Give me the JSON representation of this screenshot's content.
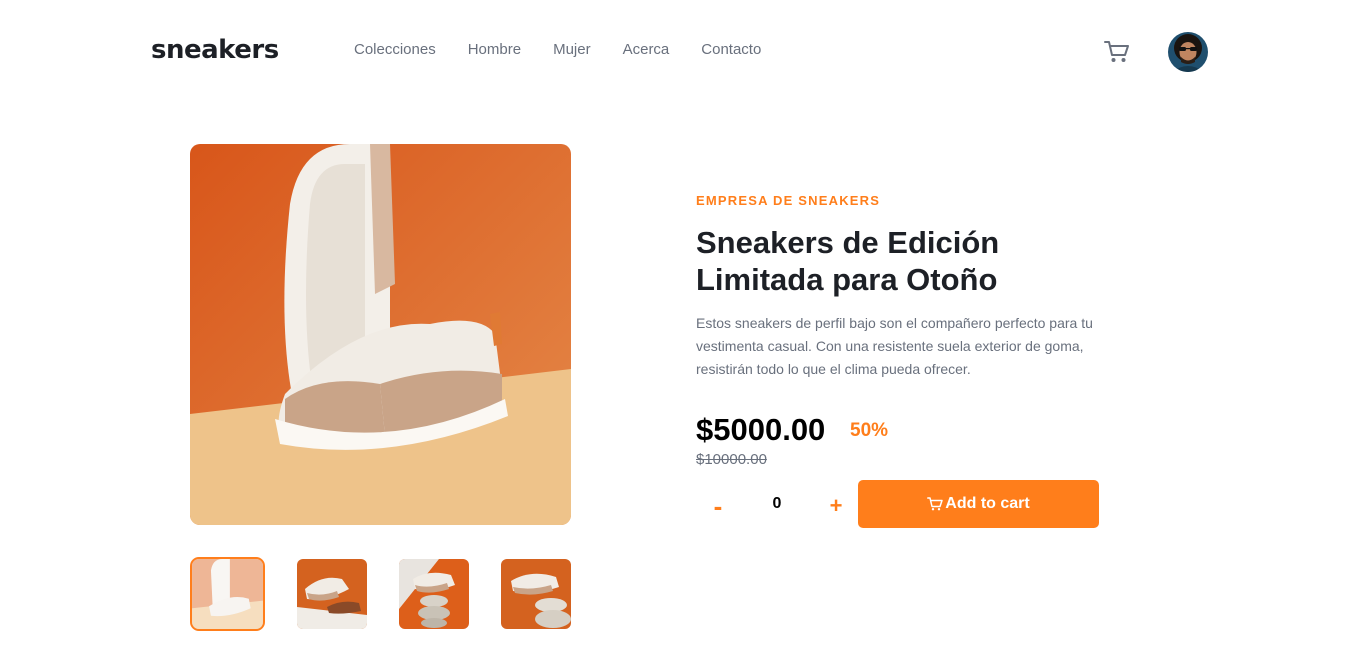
{
  "header": {
    "logo": "sneakers",
    "nav": [
      "Colecciones",
      "Hombre",
      "Mujer",
      "Acerca",
      "Contacto"
    ],
    "cart_icon": "cart-icon",
    "avatar_icon": "avatar"
  },
  "product": {
    "company": "EMPRESA DE SNEAKERS",
    "title": "Sneakers de Edición Limitada para Otoño",
    "description": "Estos sneakers de perfil bajo son el compañero perfecto para tu vestimenta casual. Con una resistente suela exterior de goma, resistirán todo lo que el clima pueda ofrecer.",
    "price": "$5000.00",
    "discount": "50%",
    "old_price": "$10000.00"
  },
  "cart": {
    "minus": "-",
    "quantity": "0",
    "plus": "+",
    "add_label": "Add to cart"
  },
  "colors": {
    "accent": "#ff7e1b",
    "dark_text": "#1d2026",
    "muted_text": "#69707d",
    "product_orange": "#e0641e",
    "product_floor": "#eec38a"
  }
}
